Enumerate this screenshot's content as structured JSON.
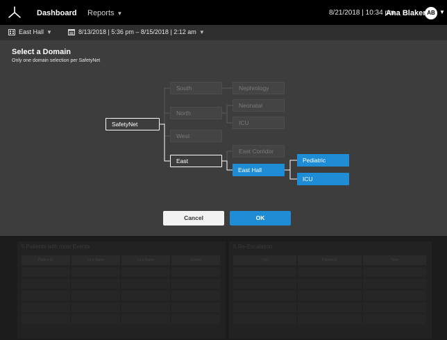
{
  "topbar": {
    "nav": [
      {
        "label": "Dashboard"
      },
      {
        "label": "Reports"
      }
    ],
    "datetime": "8/21/2018 | 10:34 pm",
    "user_name": "Ana Blaker",
    "avatar_initials": "AB",
    "icons": {
      "logo": "app-logo-icon",
      "caret": "caret-down-icon"
    }
  },
  "filterbar": {
    "unit": "East Hall",
    "range": "8/13/2018 | 5:36 pm – 8/15/2018 | 2:12 am",
    "icons": {
      "unit": "building-icon",
      "range": "calendar-icon"
    }
  },
  "modal": {
    "title": "Select a Domain",
    "subtitle": "Only one domain selection per SafetyNet",
    "root": "SafetyNet",
    "regions": [
      {
        "label": "South",
        "state": "disabled"
      },
      {
        "label": "North",
        "state": "disabled"
      },
      {
        "label": "West",
        "state": "disabled"
      },
      {
        "label": "East",
        "state": "active"
      }
    ],
    "units": [
      {
        "label": "Nephrology",
        "state": "disabled"
      },
      {
        "label": "Neonatal",
        "state": "disabled"
      },
      {
        "label": "ICU",
        "state": "disabled"
      },
      {
        "label": "East Corridor",
        "state": "disabled"
      },
      {
        "label": "East Hall",
        "state": "selected"
      }
    ],
    "subunits": [
      {
        "label": "Pediatric",
        "state": "selected"
      },
      {
        "label": "ICU",
        "state": "selected"
      }
    ],
    "cancel_label": "Cancel",
    "ok_label": "OK"
  },
  "background": {
    "left_title": "5 Patients with most Events",
    "left_columns": [
      "Patient ID",
      "First Name",
      "Last Name",
      "Events"
    ],
    "right_title": "5 Re-Escalation",
    "right_columns": [
      "Type",
      "Patient ID",
      "Time"
    ]
  }
}
